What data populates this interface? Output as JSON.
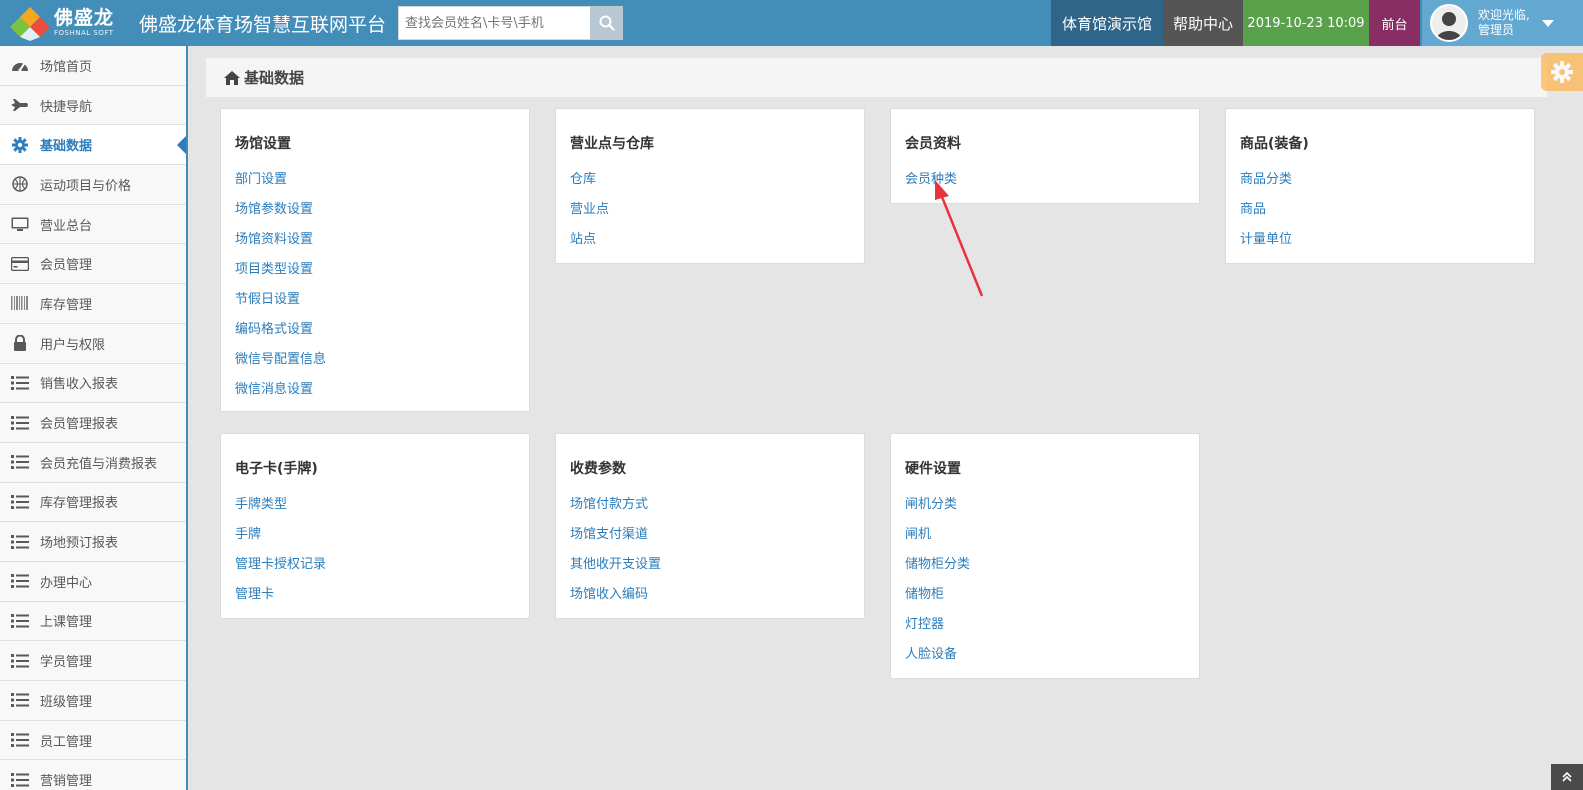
{
  "header": {
    "logo_cn": "佛盛龙",
    "logo_en": "FOSHNAL SOFT",
    "title": "佛盛龙体育场智慧互联网平台",
    "search_placeholder": "查找会员姓名\\卡号\\手机",
    "gym_name": "体育馆演示馆",
    "help": "帮助中心",
    "datetime": "2019-10-23 10:09",
    "front_desk": "前台",
    "welcome": "欢迎光临,",
    "user_role": "管理员",
    "colors": {
      "bar": "#438eb9",
      "gym": "#2e6589",
      "time": "#5aa14c",
      "front": "#892e65"
    }
  },
  "sidebar": {
    "items": [
      {
        "label": "场馆首页",
        "icon": "dashboard-icon"
      },
      {
        "label": "快捷导航",
        "icon": "plane-icon"
      },
      {
        "label": "基础数据",
        "icon": "gear-icon",
        "active": true
      },
      {
        "label": "运动项目与价格",
        "icon": "basketball-icon"
      },
      {
        "label": "营业总台",
        "icon": "desktop-icon"
      },
      {
        "label": "会员管理",
        "icon": "credit-card-icon"
      },
      {
        "label": "库存管理",
        "icon": "barcode-icon"
      },
      {
        "label": "用户与权限",
        "icon": "lock-icon"
      },
      {
        "label": "销售收入报表",
        "icon": "list-icon"
      },
      {
        "label": "会员管理报表",
        "icon": "list-icon"
      },
      {
        "label": "会员充值与消费报表",
        "icon": "list-icon"
      },
      {
        "label": "库存管理报表",
        "icon": "list-icon"
      },
      {
        "label": "场地预订报表",
        "icon": "list-icon"
      },
      {
        "label": "办理中心",
        "icon": "list-icon"
      },
      {
        "label": "上课管理",
        "icon": "list-icon"
      },
      {
        "label": "学员管理",
        "icon": "list-icon"
      },
      {
        "label": "班级管理",
        "icon": "list-icon"
      },
      {
        "label": "员工管理",
        "icon": "list-icon"
      },
      {
        "label": "营销管理",
        "icon": "list-icon"
      }
    ]
  },
  "breadcrumb": {
    "title": "基础数据"
  },
  "cards": [
    {
      "title": "场馆设置",
      "links": [
        "部门设置",
        "场馆参数设置",
        "场馆资料设置",
        "项目类型设置",
        "节假日设置",
        "编码格式设置",
        "微信号配置信息",
        "微信消息设置"
      ]
    },
    {
      "title": "营业点与仓库",
      "links": [
        "仓库",
        "营业点",
        "站点"
      ]
    },
    {
      "title": "会员资料",
      "links": [
        "会员种类"
      ]
    },
    {
      "title": "商品(装备)",
      "links": [
        "商品分类",
        "商品",
        "计量单位"
      ]
    },
    {
      "title": "电子卡(手牌)",
      "links": [
        "手牌类型",
        "手牌",
        "管理卡授权记录",
        "管理卡"
      ]
    },
    {
      "title": "收费参数",
      "links": [
        "场馆付款方式",
        "场馆支付渠道",
        "其他收开支设置",
        "场馆收入编码"
      ]
    },
    {
      "title": "硬件设置",
      "links": [
        "闸机分类",
        "闸机",
        "储物柜分类",
        "储物柜",
        "灯控器",
        "人脸设备"
      ]
    }
  ]
}
